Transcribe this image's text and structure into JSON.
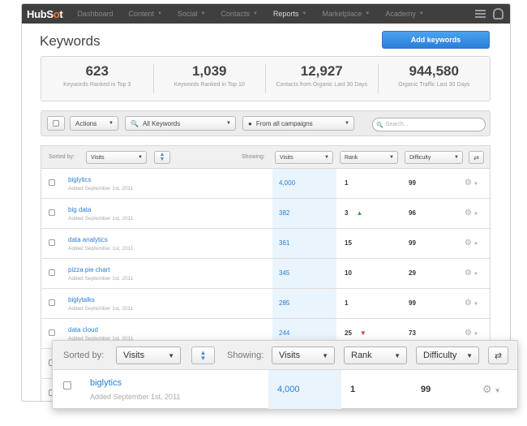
{
  "nav": {
    "logo_a": "HubS",
    "logo_b": "o",
    "logo_c": "t",
    "items": [
      {
        "label": "Dashboard"
      },
      {
        "label": "Content",
        "caret": "▼"
      },
      {
        "label": "Social",
        "caret": "▼"
      },
      {
        "label": "Contacts",
        "caret": "▼"
      },
      {
        "label": "Reports",
        "caret": "▼"
      },
      {
        "label": "Marketplace",
        "caret": "▼"
      },
      {
        "label": "Academy",
        "caret": "▼"
      }
    ]
  },
  "page": {
    "title": "Keywords",
    "add_button": "Add keywords"
  },
  "stats": [
    {
      "value": "623",
      "label": "Keywords Ranked in Top 3"
    },
    {
      "value": "1,039",
      "label": "Keywords Ranked in Top 10"
    },
    {
      "value": "12,927",
      "label": "Contacts from Organic Last 30 Days"
    },
    {
      "value": "944,580",
      "label": "Organic Traffic Last 30 Days"
    }
  ],
  "filters": {
    "actions": "Actions",
    "keywords": "All Keywords",
    "campaigns": "From all campaigns",
    "search_placeholder": "Search..."
  },
  "table": {
    "sorted_by_label": "Sorted by:",
    "sorted_by_value": "Visits",
    "showing_label": "Showing:",
    "col1": "Visits",
    "col2": "Rank",
    "col3": "Difficulty",
    "rows": [
      {
        "keyword": "biglytics",
        "added": "Added September 1st, 2011",
        "visits": "4,000",
        "rank": "1",
        "trend": "",
        "difficulty": "99"
      },
      {
        "keyword": "big data",
        "added": "Added September 1st, 2011",
        "visits": "382",
        "rank": "3",
        "trend": "▲",
        "difficulty": "96"
      },
      {
        "keyword": "data analytics",
        "added": "Added September 1st, 2011",
        "visits": "361",
        "rank": "15",
        "trend": "",
        "difficulty": "99"
      },
      {
        "keyword": "pizza pie chart",
        "added": "Added September 1st, 2011",
        "visits": "345",
        "rank": "10",
        "trend": "",
        "difficulty": "29"
      },
      {
        "keyword": "biglytalks",
        "added": "Added September 1st, 2011",
        "visits": "285",
        "rank": "1",
        "trend": "",
        "difficulty": "99"
      },
      {
        "keyword": "data cloud",
        "added": "Added September 1st, 2011",
        "visits": "244",
        "rank": "25",
        "trend": "▼",
        "difficulty": "73"
      }
    ]
  },
  "zoom": {
    "sorted_by_label": "Sorted by:",
    "sorted_by_value": "Visits",
    "showing_label": "Showing:",
    "col1": "Visits",
    "col2": "Rank",
    "col3": "Difficulty",
    "keyword": "biglytics",
    "added": "Added September 1st, 2011",
    "visits": "4,000",
    "rank": "1",
    "difficulty": "99"
  },
  "colors": {
    "accent": "#2a7fd4",
    "nav_bg": "#3f3f3f",
    "logo_accent": "#f57722",
    "up": "#3aa03a",
    "down": "#d23a3a"
  },
  "icons": {
    "gear": "gear-icon",
    "search": "search-icon",
    "globe": "globe-icon",
    "swap": "swap-icon",
    "sort": "sort-arrows-icon"
  }
}
